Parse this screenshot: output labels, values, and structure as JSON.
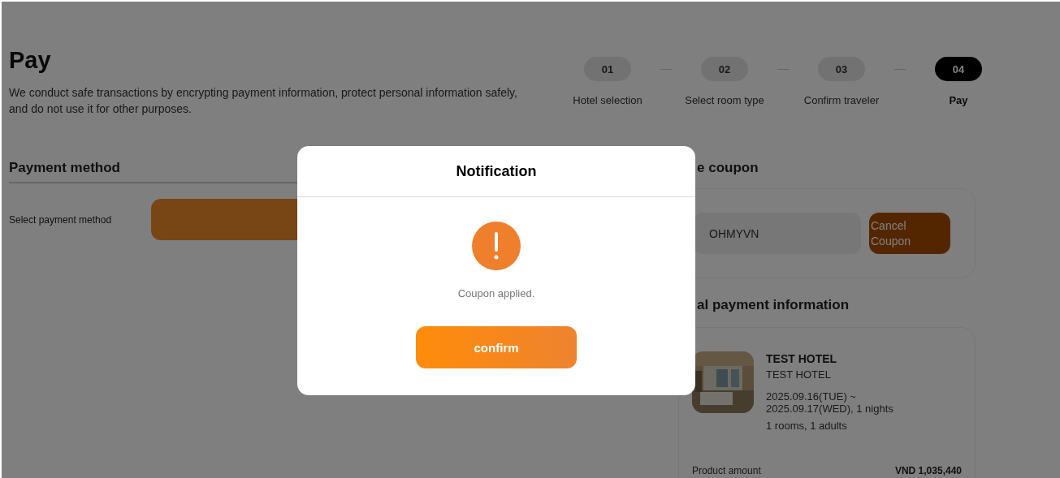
{
  "page": {
    "title": "Pay",
    "description": "We conduct safe transactions by encrypting payment information, protect personal information safely, and do not use it for other purposes."
  },
  "steps": [
    {
      "number": "01",
      "label": "Hotel selection",
      "selected": false
    },
    {
      "number": "02",
      "label": "Select room type",
      "selected": false
    },
    {
      "number": "03",
      "label": "Confirm traveler",
      "selected": false
    },
    {
      "number": "04",
      "label": "Pay",
      "selected": true
    }
  ],
  "payment_method": {
    "heading": "Payment method",
    "label": "Select payment method"
  },
  "coupon": {
    "heading": "e coupon",
    "code": "OHMYVN",
    "button": "Cancel Coupon"
  },
  "payment_info": {
    "heading": "al payment information",
    "hotel": {
      "kind": "picture",
      "name": "TEST HOTEL",
      "subtitle": "TEST HOTEL",
      "dates": "2025.09.16(TUE) ~ 2025.09.17(WED), 1 nights",
      "guests": "1 rooms, 1 adults"
    },
    "rows": [
      {
        "label": "Product amount",
        "value": "VND 1,035,440"
      }
    ]
  },
  "dialog": {
    "title": "Notification",
    "message": "Coupon applied.",
    "button": "confirm"
  }
}
